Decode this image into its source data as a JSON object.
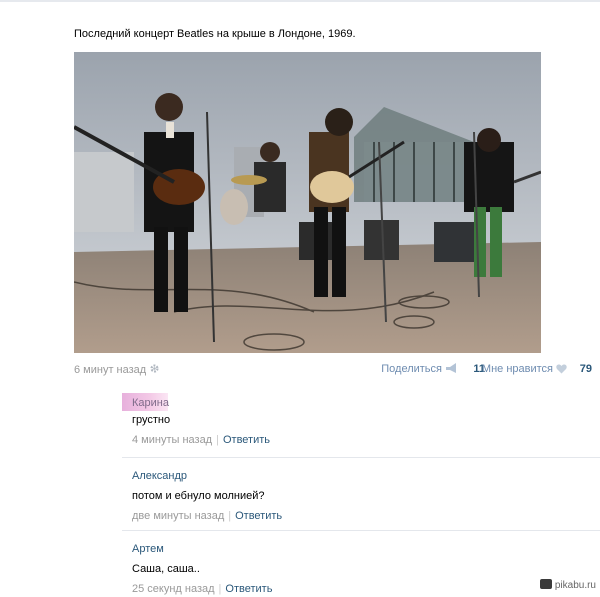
{
  "post": {
    "text": "Последний концерт Beatles на крыше в Лондоне, 1969.",
    "time": "6 минут назад",
    "share_label": "Поделиться",
    "share_count": "11",
    "like_label": "Мне нравится",
    "like_count": "79"
  },
  "comments": [
    {
      "author": "Карина",
      "text": "грустно",
      "time": "4 минуты назад",
      "reply": "Ответить"
    },
    {
      "author": "Александр",
      "text": "потом и ебнуло молнией?",
      "time": "две минуты назад",
      "reply": "Ответить"
    },
    {
      "author": "Артем",
      "text": "Саша, саша..",
      "time": "25 секунд назад",
      "reply": "Ответить"
    }
  ],
  "watermark": "pikabu.ru",
  "colors": {
    "link": "#2b587a",
    "muted": "#999999",
    "action": "#6e8cb0"
  },
  "icons": [
    "gear-icon",
    "megaphone-icon",
    "heart-icon",
    "pikabu-logo-icon"
  ]
}
